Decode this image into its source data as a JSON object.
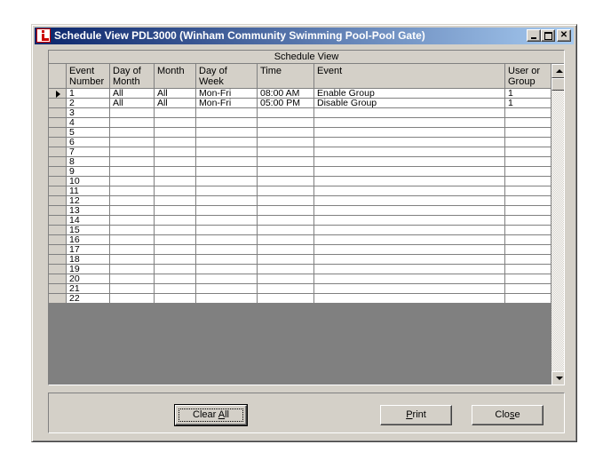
{
  "window": {
    "title": "Schedule View PDL3000 (Winham Community Swimming Pool-Pool Gate)"
  },
  "grid": {
    "caption": "Schedule View",
    "columns": [
      "Event Number",
      "Day of Month",
      "Month",
      "Day of Week",
      "Time",
      "Event",
      "User or Group"
    ],
    "rows": [
      [
        "1",
        "All",
        "All",
        "Mon-Fri",
        "08:00 AM",
        "Enable Group",
        "1"
      ],
      [
        "2",
        "All",
        "All",
        "Mon-Fri",
        "05:00 PM",
        "Disable Group",
        "1"
      ],
      [
        "3",
        "",
        "",
        "",
        "",
        "",
        ""
      ],
      [
        "4",
        "",
        "",
        "",
        "",
        "",
        ""
      ],
      [
        "5",
        "",
        "",
        "",
        "",
        "",
        ""
      ],
      [
        "6",
        "",
        "",
        "",
        "",
        "",
        ""
      ],
      [
        "7",
        "",
        "",
        "",
        "",
        "",
        ""
      ],
      [
        "8",
        "",
        "",
        "",
        "",
        "",
        ""
      ],
      [
        "9",
        "",
        "",
        "",
        "",
        "",
        ""
      ],
      [
        "10",
        "",
        "",
        "",
        "",
        "",
        ""
      ],
      [
        "11",
        "",
        "",
        "",
        "",
        "",
        ""
      ],
      [
        "12",
        "",
        "",
        "",
        "",
        "",
        ""
      ],
      [
        "13",
        "",
        "",
        "",
        "",
        "",
        ""
      ],
      [
        "14",
        "",
        "",
        "",
        "",
        "",
        ""
      ],
      [
        "15",
        "",
        "",
        "",
        "",
        "",
        ""
      ],
      [
        "16",
        "",
        "",
        "",
        "",
        "",
        ""
      ],
      [
        "17",
        "",
        "",
        "",
        "",
        "",
        ""
      ],
      [
        "18",
        "",
        "",
        "",
        "",
        "",
        ""
      ],
      [
        "19",
        "",
        "",
        "",
        "",
        "",
        ""
      ],
      [
        "20",
        "",
        "",
        "",
        "",
        "",
        ""
      ],
      [
        "21",
        "",
        "",
        "",
        "",
        "",
        ""
      ],
      [
        "22",
        "",
        "",
        "",
        "",
        "",
        ""
      ]
    ],
    "current_row": 1
  },
  "buttons": {
    "clear_all": {
      "pre": "Clear ",
      "key": "A",
      "post": "ll"
    },
    "print": {
      "pre": "",
      "key": "P",
      "post": "rint"
    },
    "close": {
      "pre": "Clo",
      "key": "s",
      "post": "e"
    }
  },
  "icons": [
    "app-icon",
    "minimize-icon",
    "maximize-icon",
    "close-icon",
    "row-pointer-icon",
    "scroll-up-icon",
    "scroll-down-icon"
  ]
}
